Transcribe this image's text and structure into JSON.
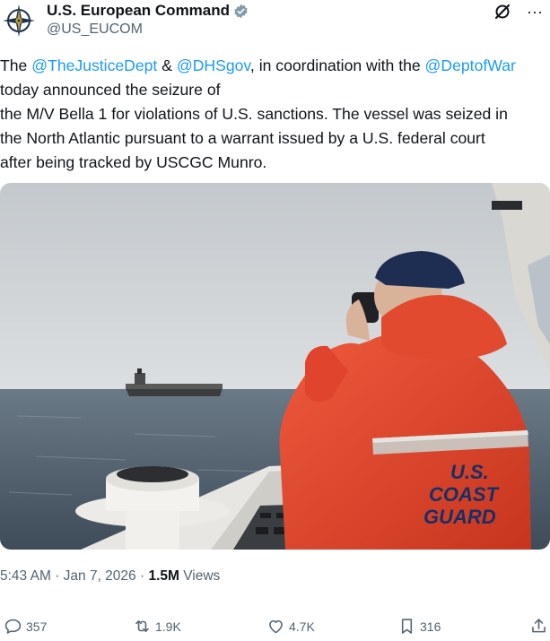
{
  "account": {
    "display_name": "U.S. European Command",
    "handle": "@US_EUCOM",
    "avatar_icon": "eucom-compass-emblem",
    "verified_icon": "verified-badge-icon"
  },
  "header_actions": {
    "grok_icon": "grok-icon",
    "more_icon": "more-options-icon",
    "more_glyph": "···"
  },
  "tweet": {
    "line1": {
      "t1": "The ",
      "m1": "@TheJusticeDept",
      "t2": " & ",
      "m2": "@DHSgov",
      "t3": ", in coordination with the ",
      "m3": "@DeptofWar"
    },
    "line2": "today announced the seizure of",
    "line3": "the M/V Bella 1 for violations of U.S. sanctions. The vessel was seized in",
    "line4": "the North Atlantic pursuant to a warrant issued by a U.S. federal court",
    "line5": "after being tracked by USCGC Munro."
  },
  "media": {
    "jacket_text_1": "U.S.",
    "jacket_text_2": "COAST",
    "jacket_text_3": "GUARD"
  },
  "meta": {
    "time": "5:43 AM",
    "separator": " · ",
    "date": "Jan 7, 2026",
    "views_count": "1.5M",
    "views_label": " Views"
  },
  "actions": {
    "replies": "357",
    "reposts": "1.9K",
    "likes": "4.7K",
    "bookmarks": "316"
  },
  "colors": {
    "text": "#0f1419",
    "secondary": "#536471",
    "link": "#1d9bf0",
    "verified": "#829aab",
    "jacket": "#e0442c"
  }
}
